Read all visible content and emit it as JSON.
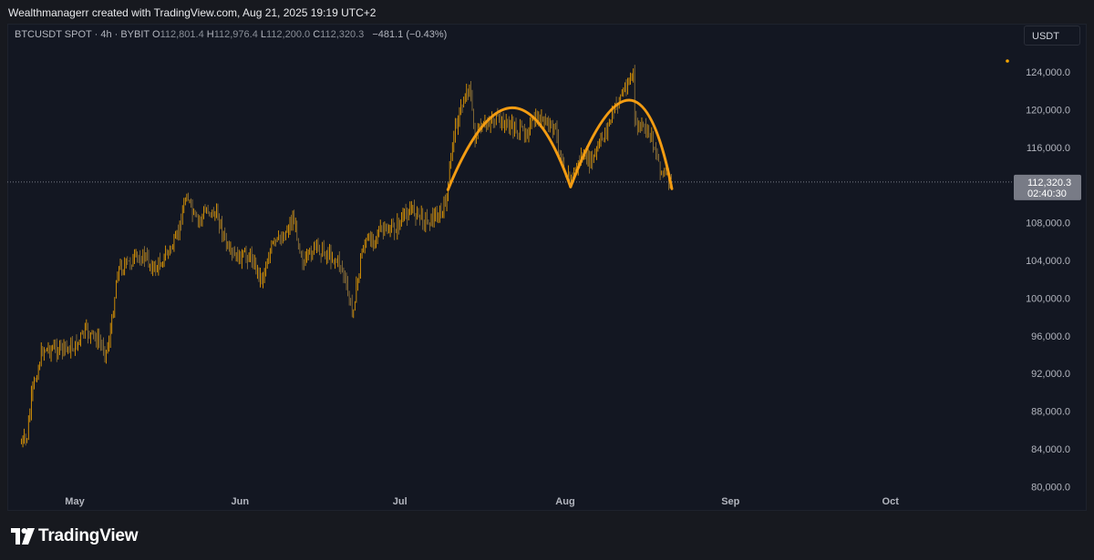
{
  "header": {
    "attribution": "Wealthmanagerr created with TradingView.com, Aug 21, 2025 19:19 UTC+2"
  },
  "legend": {
    "symbol": "BTCUSDT SPOT · 4h · BYBIT",
    "o_label": "O",
    "o_value": "112,801.4",
    "h_label": "H",
    "h_value": "112,976.4",
    "l_label": "L",
    "l_value": "112,200.0",
    "c_label": "C",
    "c_value": "112,320.3",
    "change": "−481.1 (−0.43%)"
  },
  "currency_button": "USDT",
  "price_tag": {
    "price": "112,320.3",
    "countdown": "02:40:30"
  },
  "footer": {
    "brand": "TradingView",
    "logo_icon": "tradingview-logo-icon"
  },
  "colors": {
    "background": "#131722",
    "candle": "#f7a600",
    "pattern": "#f39c12",
    "axis_text": "#b2b5be",
    "price_tag": "#787b86"
  },
  "chart_data": {
    "type": "candlestick",
    "title": "",
    "xlabel": "",
    "ylabel": "",
    "ylim": [
      80000,
      126000
    ],
    "x_range": [
      "2025-04-21",
      "2025-10-25"
    ],
    "grid": false,
    "scale": "linear",
    "y_ticks": [
      "124,000.0",
      "120,000.0",
      "116,000.0",
      "112,000.0",
      "108,000.0",
      "104,000.0",
      "100,000.0",
      "96,000.0",
      "92,000.0",
      "88,000.0",
      "84,000.0",
      "80,000.0"
    ],
    "x_ticks": [
      {
        "label": "May",
        "date": "2025-05-01"
      },
      {
        "label": "Jun",
        "date": "2025-06-01"
      },
      {
        "label": "Jul",
        "date": "2025-07-01"
      },
      {
        "label": "Aug",
        "date": "2025-08-01"
      },
      {
        "label": "Sep",
        "date": "2025-09-01"
      },
      {
        "label": "Oct",
        "date": "2025-10-01"
      }
    ],
    "price_path": [
      {
        "date": "2025-04-21",
        "price": 84600
      },
      {
        "date": "2025-04-22",
        "price": 85000
      },
      {
        "date": "2025-04-23",
        "price": 90000
      },
      {
        "date": "2025-04-25",
        "price": 94600
      },
      {
        "date": "2025-04-28",
        "price": 94600
      },
      {
        "date": "2025-05-01",
        "price": 94800
      },
      {
        "date": "2025-05-03",
        "price": 96500
      },
      {
        "date": "2025-05-05",
        "price": 95700
      },
      {
        "date": "2025-05-07",
        "price": 94300
      },
      {
        "date": "2025-05-08",
        "price": 97500
      },
      {
        "date": "2025-05-09",
        "price": 103000
      },
      {
        "date": "2025-05-12",
        "price": 104000
      },
      {
        "date": "2025-05-14",
        "price": 104500
      },
      {
        "date": "2025-05-16",
        "price": 103000
      },
      {
        "date": "2025-05-18",
        "price": 104500
      },
      {
        "date": "2025-05-20",
        "price": 106000
      },
      {
        "date": "2025-05-22",
        "price": 111200
      },
      {
        "date": "2025-05-23",
        "price": 109000
      },
      {
        "date": "2025-05-24",
        "price": 108000
      },
      {
        "date": "2025-05-26",
        "price": 109500
      },
      {
        "date": "2025-05-28",
        "price": 108500
      },
      {
        "date": "2025-05-30",
        "price": 104500
      },
      {
        "date": "2025-06-01",
        "price": 104300
      },
      {
        "date": "2025-06-03",
        "price": 104500
      },
      {
        "date": "2025-06-05",
        "price": 102000
      },
      {
        "date": "2025-06-07",
        "price": 105500
      },
      {
        "date": "2025-06-09",
        "price": 106500
      },
      {
        "date": "2025-06-11",
        "price": 108500
      },
      {
        "date": "2025-06-13",
        "price": 103500
      },
      {
        "date": "2025-06-15",
        "price": 105500
      },
      {
        "date": "2025-06-18",
        "price": 104500
      },
      {
        "date": "2025-06-20",
        "price": 103500
      },
      {
        "date": "2025-06-22",
        "price": 98500
      },
      {
        "date": "2025-06-23",
        "price": 101500
      },
      {
        "date": "2025-06-24",
        "price": 105500
      },
      {
        "date": "2025-06-27",
        "price": 107000
      },
      {
        "date": "2025-06-30",
        "price": 107300
      },
      {
        "date": "2025-07-03",
        "price": 109500
      },
      {
        "date": "2025-07-06",
        "price": 108200
      },
      {
        "date": "2025-07-09",
        "price": 109000
      },
      {
        "date": "2025-07-10",
        "price": 111500
      },
      {
        "date": "2025-07-11",
        "price": 117500
      },
      {
        "date": "2025-07-14",
        "price": 122800
      },
      {
        "date": "2025-07-15",
        "price": 117000
      },
      {
        "date": "2025-07-18",
        "price": 119000
      },
      {
        "date": "2025-07-21",
        "price": 118500
      },
      {
        "date": "2025-07-24",
        "price": 117500
      },
      {
        "date": "2025-07-27",
        "price": 119000
      },
      {
        "date": "2025-07-30",
        "price": 118000
      },
      {
        "date": "2025-08-01",
        "price": 113500
      },
      {
        "date": "2025-08-02",
        "price": 112500
      },
      {
        "date": "2025-08-04",
        "price": 115000
      },
      {
        "date": "2025-08-06",
        "price": 114500
      },
      {
        "date": "2025-08-08",
        "price": 117000
      },
      {
        "date": "2025-08-11",
        "price": 121000
      },
      {
        "date": "2025-08-14",
        "price": 124200
      },
      {
        "date": "2025-08-14",
        "price": 118500
      },
      {
        "date": "2025-08-17",
        "price": 117500
      },
      {
        "date": "2025-08-19",
        "price": 113500
      },
      {
        "date": "2025-08-21",
        "price": 112300
      }
    ],
    "last_price": 112320.3,
    "pattern": {
      "name": "double top",
      "arcs": [
        [
          [
            "2025-07-10",
            111500
          ],
          [
            "2025-07-22",
            120200
          ],
          [
            "2025-08-02",
            111800
          ]
        ],
        [
          [
            "2025-08-02",
            111800
          ],
          [
            "2025-08-13",
            121000
          ],
          [
            "2025-08-21",
            111600
          ]
        ]
      ]
    }
  }
}
